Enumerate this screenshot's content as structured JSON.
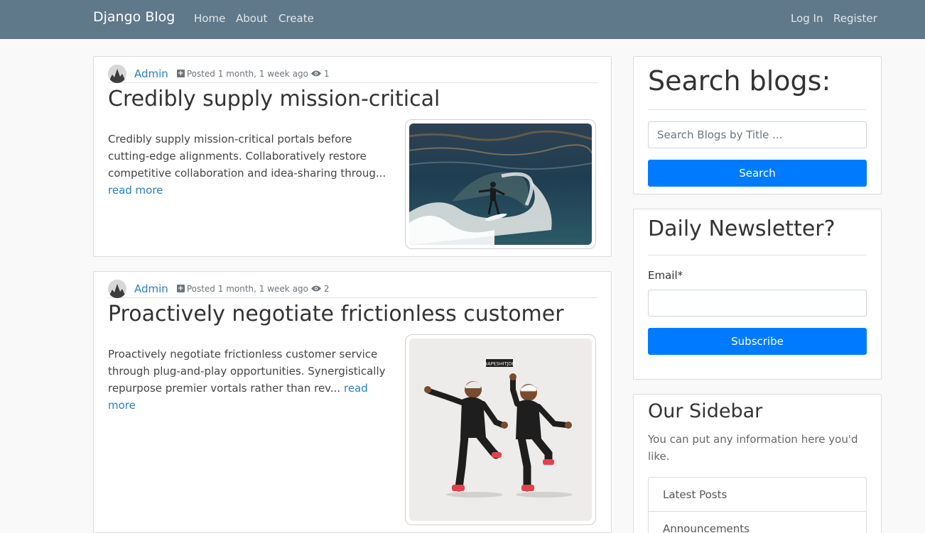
{
  "navbar": {
    "brand": "Django Blog",
    "links": [
      "Home",
      "About",
      "Create"
    ],
    "auth_links": [
      "Log In",
      "Register"
    ],
    "background_color": "#5f788a"
  },
  "posts": [
    {
      "author": "Admin",
      "posted_prefix": "Posted",
      "posted_ago": "1 month, 1 week ago",
      "views": "1",
      "title": "Credibly supply mission-critical",
      "excerpt": "Credibly supply mission-critical portals before cutting-edge alignments. Collaboratively restore competitive collaboration and idea-sharing throug...",
      "read_more": "read more",
      "image": "surfer-on-wave-photo"
    },
    {
      "author": "Admin",
      "posted_prefix": "Posted",
      "posted_ago": "1 month, 1 week ago",
      "views": "2",
      "title": "Proactively negotiate frictionless customer",
      "excerpt": "Proactively negotiate frictionless customer service through plug-and-play opportunities. Synergistically repurpose premier vortals rather than rev...",
      "read_more": "read more",
      "image": "cartoon-dancers-illustration",
      "image_caption": "@APESHITJDM"
    }
  ],
  "search_widget": {
    "title": "Search blogs:",
    "placeholder": "Search Blogs by Title ...",
    "button": "Search"
  },
  "newsletter_widget": {
    "title": "Daily Newsletter?",
    "email_label": "Email*",
    "button": "Subscribe"
  },
  "sidebar_widget": {
    "title": "Our Sidebar",
    "text": "You can put any information here you'd like.",
    "items": [
      "Latest Posts",
      "Announcements"
    ]
  },
  "colors": {
    "primary": "#007bff",
    "link": "#2a7ec3"
  }
}
